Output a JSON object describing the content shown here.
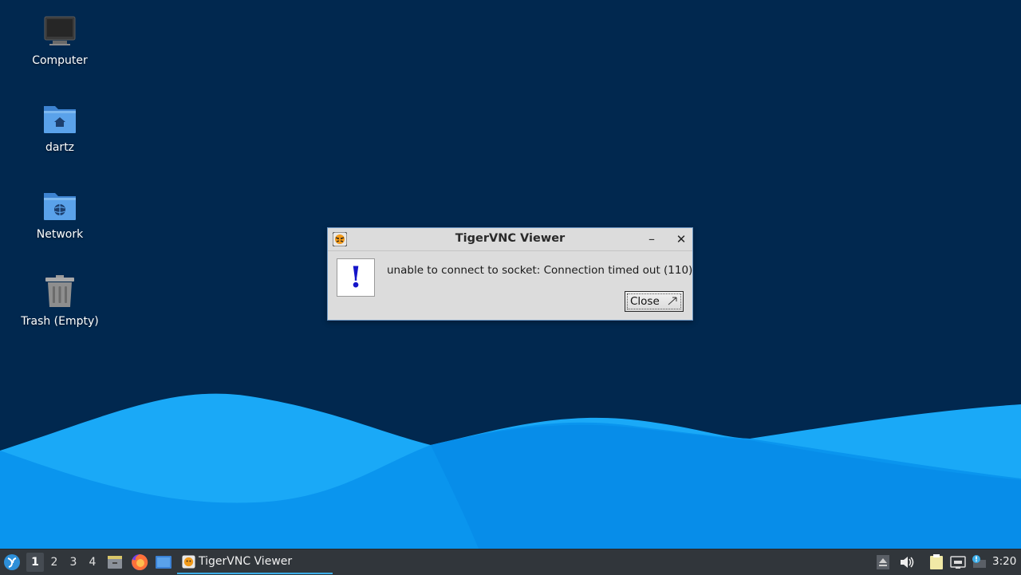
{
  "desktop": {
    "background": "#01284f",
    "wave_colors": [
      "#0587e6",
      "#0a99f2",
      "#1aa9f7"
    ],
    "icons": [
      {
        "label": "Computer",
        "icon": "computer-icon"
      },
      {
        "label": "dartz",
        "icon": "home-folder-icon"
      },
      {
        "label": "Network",
        "icon": "network-folder-icon"
      },
      {
        "label": "Trash (Empty)",
        "icon": "trash-icon"
      }
    ]
  },
  "dialog": {
    "title": "TigerVNC Viewer",
    "minimize_glyph": "–",
    "close_glyph": "✕",
    "alert_glyph": "!",
    "message": "unable to connect to socket: Connection timed out (110)",
    "close_button_label": "Close"
  },
  "taskbar": {
    "workspaces": [
      "1",
      "2",
      "3",
      "4"
    ],
    "active_workspace": "1",
    "task_label": "TigerVNC Viewer",
    "clock": "3:20",
    "accent": "#3daee9"
  }
}
